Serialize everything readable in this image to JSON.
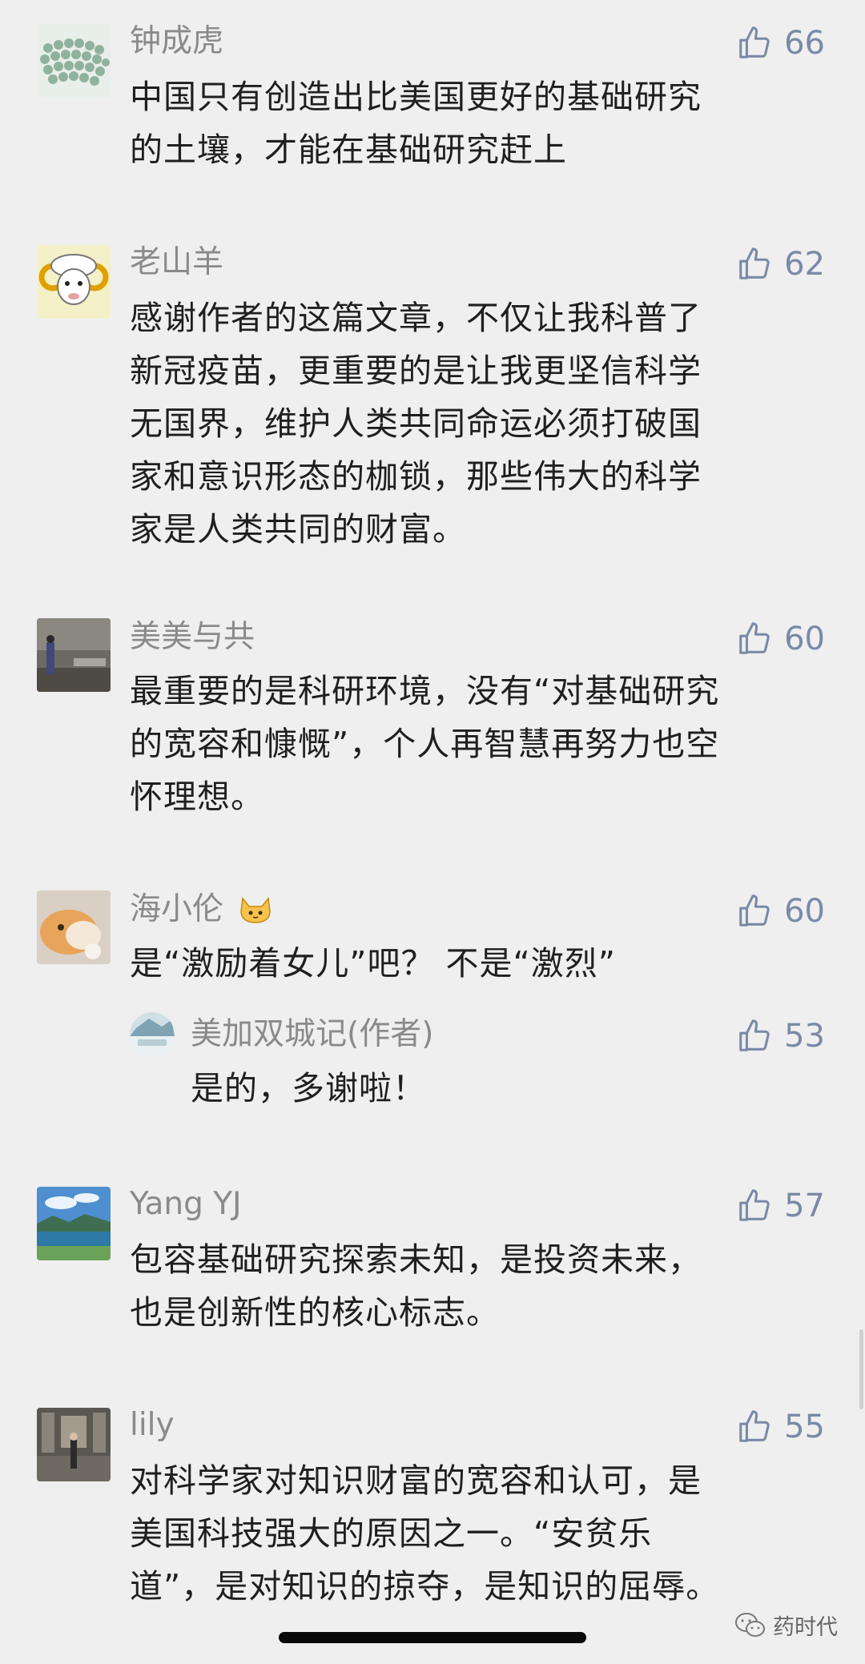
{
  "comments": [
    {
      "name": "钟成虎",
      "likes": "66",
      "lines": [
        "中国只有创造出比美国更好的基础研究",
        "的土壤，才能在基础研究赶上"
      ]
    },
    {
      "name": "老山羊",
      "likes": "62",
      "lines": [
        "感谢作者的这篇文章，不仅让我科普了",
        "新冠疫苗，更重要的是让我更坚信科学",
        "无国界，维护人类共同命运必须打破国",
        "家和意识形态的枷锁，那些伟大的科学",
        "家是人类共同的财富。"
      ]
    },
    {
      "name": "美美与共",
      "likes": "60",
      "lines": [
        "最重要的是科研环境，没有“对基础研究",
        "的宽容和慷慨”，个人再智慧再努力也空",
        "怀理想。"
      ]
    },
    {
      "name": "海小伦",
      "name_emoji": "🐱",
      "likes": "60",
      "lines": [
        "是“激励着女儿”吧？ 不是“激烈”"
      ],
      "reply": {
        "name": "美加双城记(作者)",
        "likes": "53",
        "lines": [
          "是的，多谢啦！"
        ]
      }
    },
    {
      "name": "Yang YJ",
      "likes": "57",
      "lines": [
        "包容基础研究探索未知，是投资未来，",
        "也是创新性的核心标志。"
      ]
    },
    {
      "name": "lily",
      "likes": "55",
      "lines": [
        "对科学家对知识财富的宽容和认可，是",
        "美国科技强大的原因之一。“安贫乐",
        "道”，是对知识的掠夺，是知识的屈辱。"
      ]
    }
  ],
  "watermark": {
    "icon": "wechat-icon",
    "text": "药时代"
  },
  "icons": {
    "like": "thumbs-up-icon"
  },
  "colors": {
    "background": "#efeff0",
    "name": "#8a8a8a",
    "body": "#1f1f1f",
    "like": "#7a8aa5"
  }
}
